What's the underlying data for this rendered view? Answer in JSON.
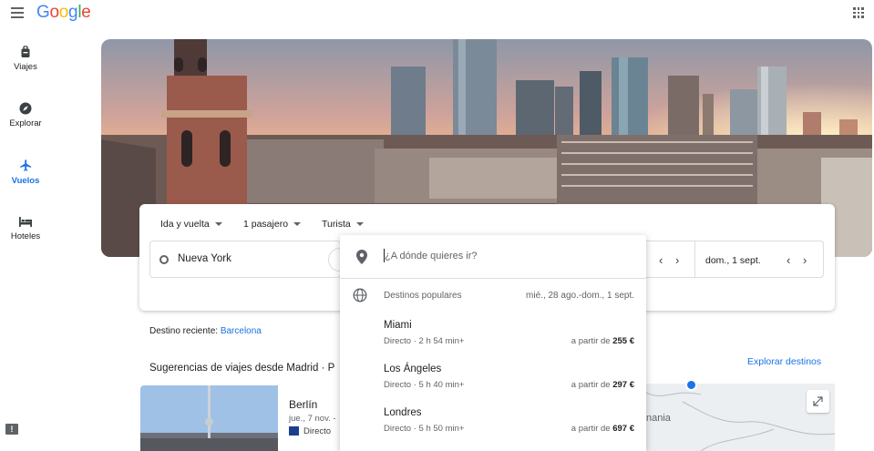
{
  "app": {
    "logo": "Google"
  },
  "nav": {
    "items": [
      {
        "label": "Viajes",
        "icon": "suitcase-icon"
      },
      {
        "label": "Explorar",
        "icon": "compass-icon"
      },
      {
        "label": "Vuelos",
        "icon": "airplane-icon",
        "active": true
      },
      {
        "label": "Hoteles",
        "icon": "bed-icon"
      }
    ]
  },
  "search": {
    "trip_type": "Ida y vuelta",
    "passengers": "1 pasajero",
    "cabin": "Turista",
    "origin": "Nueva York",
    "return_date": "dom., 1 sept."
  },
  "dropdown": {
    "placeholder": "¿A dónde quieres ir?",
    "popular_title": "Destinos populares",
    "popular_dates": "mié., 28 ago.-dom., 1 sept.",
    "destinations": [
      {
        "city": "Miami",
        "stops": "Directo",
        "duration": "2 h 54 min+",
        "price_prefix": "a partir de",
        "price": "255 €"
      },
      {
        "city": "Los Ángeles",
        "stops": "Directo",
        "duration": "5 h 40 min+",
        "price_prefix": "a partir de",
        "price": "297 €"
      },
      {
        "city": "Londres",
        "stops": "Directo",
        "duration": "5 h 50 min+",
        "price_prefix": "a partir de",
        "price": "697 €"
      }
    ]
  },
  "recent": {
    "label": "Destino reciente:",
    "city": "Barcelona"
  },
  "suggestions": {
    "title": "Sugerencias de viajes desde Madrid · P",
    "explore_link": "Explorar destinos"
  },
  "card": {
    "city": "Berlín",
    "dates": "jue., 7 nov. -",
    "route": "Directo"
  },
  "map": {
    "label": "nania"
  },
  "colors": {
    "accent": "#1a73e8",
    "text": "#202124",
    "muted": "#5f6368"
  }
}
